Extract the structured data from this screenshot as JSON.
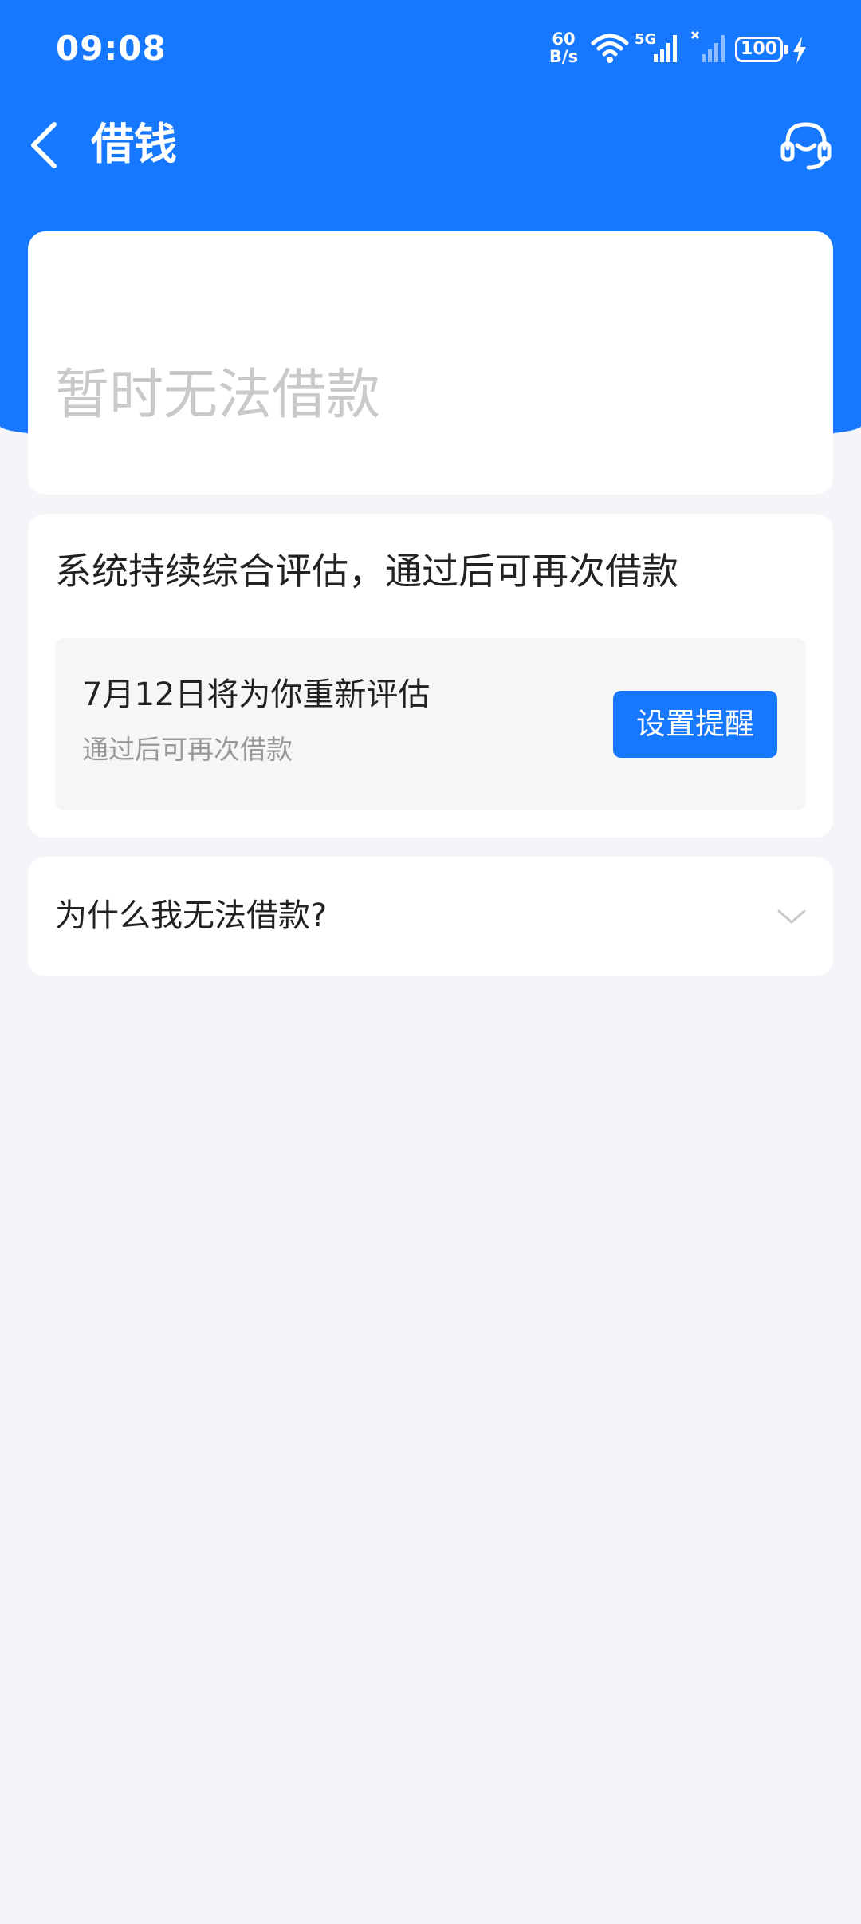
{
  "status_bar": {
    "time": "09:08",
    "net_speed_value": "60",
    "net_speed_unit": "B/s",
    "network_type": "5G",
    "battery": "100"
  },
  "nav": {
    "title": "借钱"
  },
  "status_card": {
    "text": "暂时无法借款"
  },
  "evaluation": {
    "title": "系统持续综合评估，通过后可再次借款",
    "date_text": "7月12日将为你重新评估",
    "sub_text": "通过后可再次借款",
    "button_label": "设置提醒"
  },
  "faq": {
    "question": "为什么我无法借款?"
  },
  "colors": {
    "primary": "#1677ff",
    "background": "#f4f5f8",
    "disabled_text": "#c9c9c9"
  }
}
